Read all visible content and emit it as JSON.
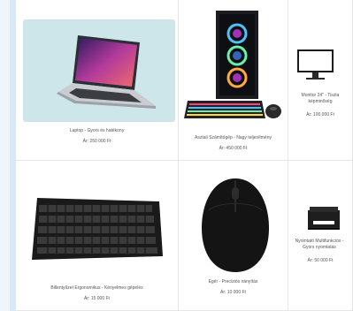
{
  "products": [
    {
      "title": "Laptop - Gyors és hatékony",
      "price": "Ár: 250 000 Ft",
      "icon": "laptop-image"
    },
    {
      "title": "Asztali Számítógép - Nagy teljesítmény",
      "price": "Ár: 450 000 Ft",
      "icon": "desktop-pc-image"
    },
    {
      "title": "Monitor 24\" - Tiszta képminőség",
      "price": "Ár: 100 000 Ft",
      "icon": "monitor-image"
    },
    {
      "title": "Billentyűzet Ergonomikus - Kényelmes gépelés",
      "price": "Ár: 15 000 Ft",
      "icon": "keyboard-image"
    },
    {
      "title": "Egér - Precíziós irányítás",
      "price": "Ár: 10 000 Ft",
      "icon": "mouse-image"
    },
    {
      "title": "Nyomtató Multifunkciós - Gyors nyomtatás",
      "price": "Ár: 50 000 Ft",
      "icon": "printer-image"
    }
  ],
  "colors": {
    "accent_strip": "#d7e9f8",
    "laptop_bg": "#cde6ea"
  }
}
